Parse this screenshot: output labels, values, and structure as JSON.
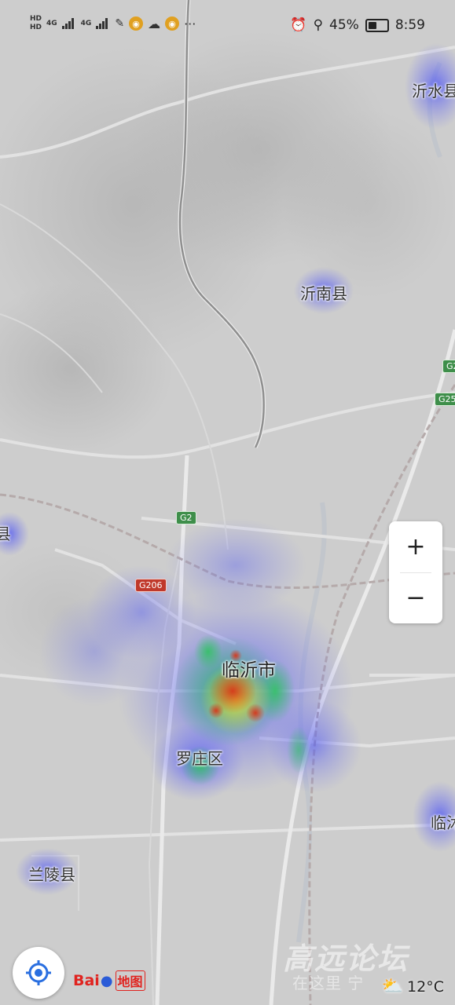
{
  "status_bar": {
    "hd1": "HD",
    "hd2": "HD",
    "net1": "4G",
    "net2": "4G",
    "battery": "45%",
    "time": "8:59",
    "icons": [
      "signal-icon",
      "wechat-icon",
      "weibo-icon",
      "more-icon",
      "alarm-icon",
      "location-icon",
      "battery-icon"
    ]
  },
  "map": {
    "places": {
      "yishui": "沂水县",
      "yinan": "沂南县",
      "linyi": "临沂市",
      "luozhuang": "罗庄区",
      "lanling": "兰陵县",
      "right_edge": "临沭",
      "left_edge": "县"
    },
    "roads": {
      "g2": "G2",
      "g206": "G206",
      "g25a": "G2",
      "g25b": "G25"
    },
    "colors": {
      "heat_low": "#5a5cf0",
      "heat_mid": "#3cc86a",
      "heat_high": "#e03a1a",
      "base": "#cfcfcf"
    }
  },
  "controls": {
    "zoom_in": "+",
    "zoom_out": "−"
  },
  "branding": {
    "logo_bai": "Bai",
    "logo_paw": "du",
    "logo_map": "地图",
    "watermark_top": "高远论坛",
    "watermark_bottom": "在这里 宁"
  },
  "weather": {
    "temperature": "12°C",
    "icon": "partly-sunny-icon"
  }
}
